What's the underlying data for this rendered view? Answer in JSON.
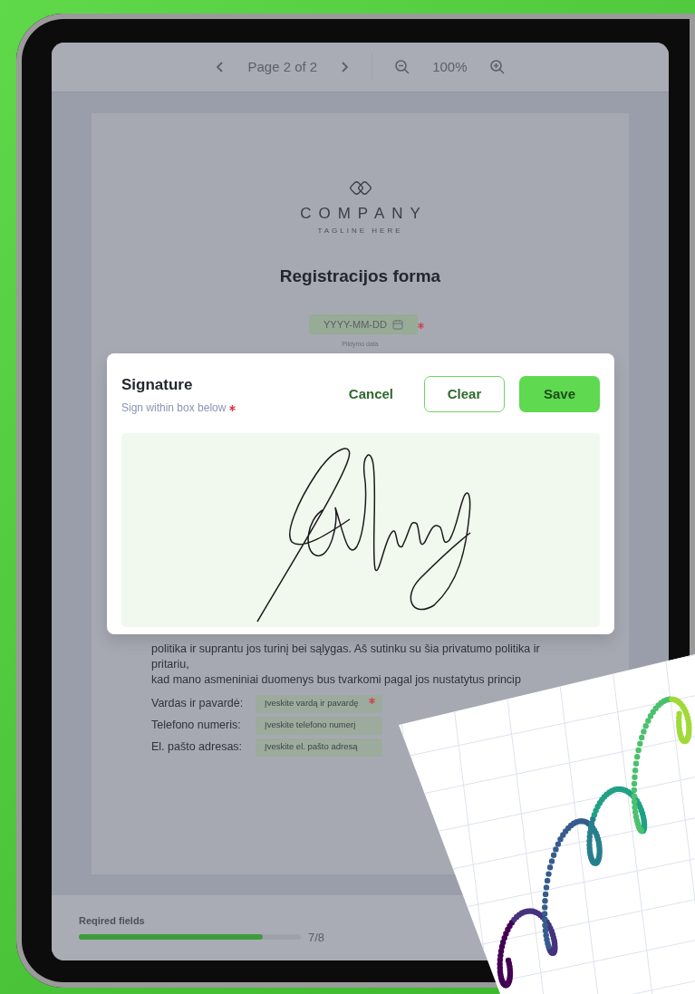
{
  "toolbar": {
    "page_label": "Page 2 of 2",
    "zoom": "100%"
  },
  "document": {
    "brand": "COMPANY",
    "tagline": "TAGLINE HERE",
    "title": "Registracijos forma",
    "date_field": {
      "placeholder": "YYYY-MM-DD",
      "required": true
    },
    "date_caption": "Pildymo data",
    "paragraph_lines": [
      "politika ir suprantu jos turinį bei sąlygas. Aš sutinku su šia privatumo politika ir",
      "pritariu,",
      "kad mano asmeniniai duomenys bus tvarkomi pagal jos nustatytus princip"
    ],
    "fields": [
      {
        "label": "Vardas ir pavardė:",
        "placeholder": "Įveskite vardą ir pavardę",
        "required": true
      },
      {
        "label": "Telefono numeris:",
        "placeholder": "Įveskite telefono numerį",
        "required": false
      },
      {
        "label": "El. pašto adresas:",
        "placeholder": "Įveskite el. pašto adresą",
        "required": false
      }
    ]
  },
  "signature_dialog": {
    "title": "Signature",
    "hint": "Sign within box below",
    "required": true,
    "buttons": [
      {
        "label": "Cancel",
        "kind": "text"
      },
      {
        "label": "Clear",
        "kind": "outline"
      },
      {
        "label": "Save",
        "kind": "filled"
      }
    ]
  },
  "progress": {
    "label": "Reqired fields",
    "level": 0.83,
    "count": "7/8"
  }
}
